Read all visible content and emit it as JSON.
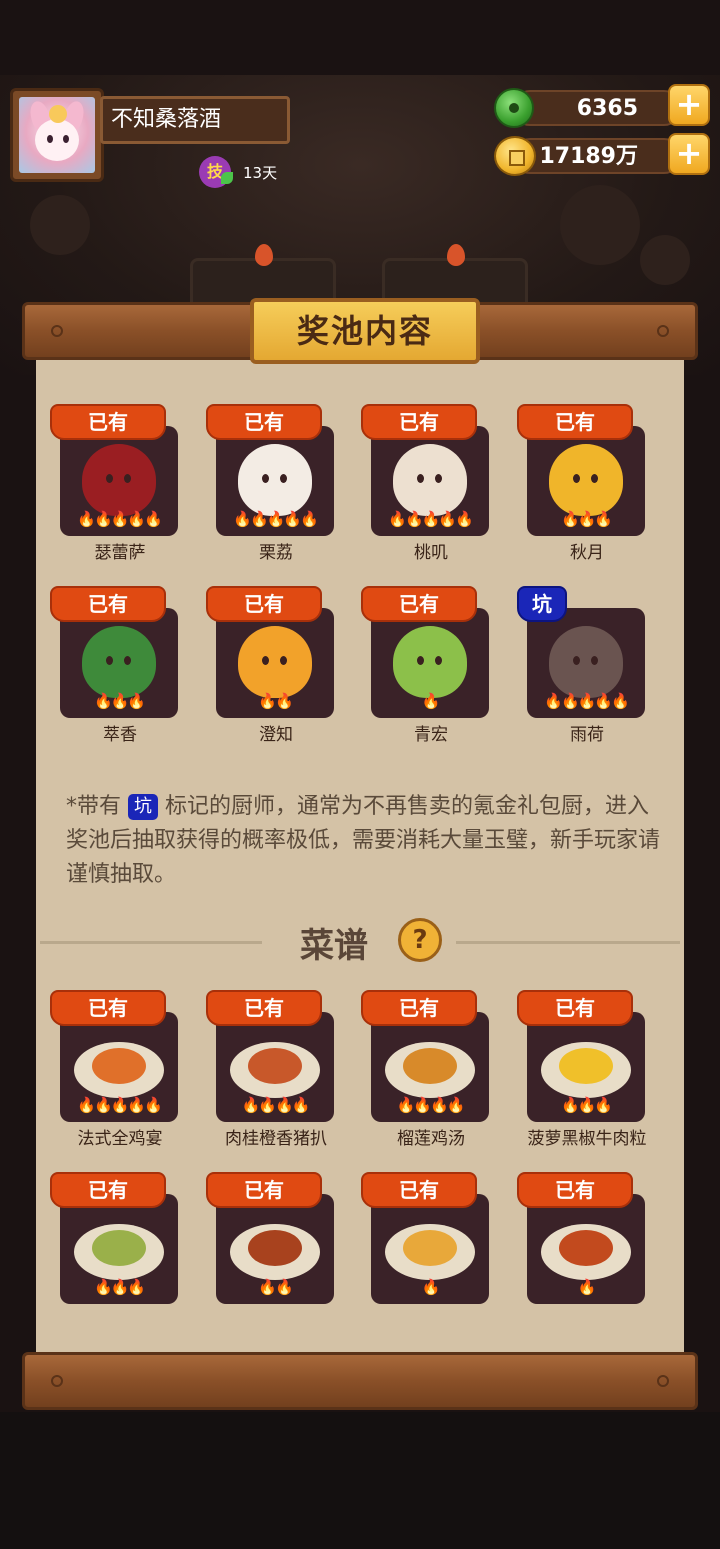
{
  "profile": {
    "name": "不知桑落酒",
    "skill_badge": "技",
    "days": "13天"
  },
  "currency": {
    "jade": "6365",
    "coins": "17189万"
  },
  "panel": {
    "title": "奖池内容",
    "chefs": [
      {
        "tag": "已有",
        "name": "瑟蕾萨",
        "stars": "🔥🔥🔥🔥🔥",
        "color": "#9a1e22"
      },
      {
        "tag": "已有",
        "name": "栗荔",
        "stars": "🔥🔥🔥🔥🔥",
        "color": "#f3ece4"
      },
      {
        "tag": "已有",
        "name": "桃叽",
        "stars": "🔥🔥🔥🔥🔥",
        "color": "#ede0d0"
      },
      {
        "tag": "已有",
        "name": "秋月",
        "stars": "🔥🔥🔥",
        "color": "#f0b52a"
      },
      {
        "tag": "已有",
        "name": "萃香",
        "stars": "🔥🔥🔥",
        "color": "#3e8a3a"
      },
      {
        "tag": "已有",
        "name": "澄知",
        "stars": "🔥🔥",
        "color": "#f2a22a"
      },
      {
        "tag": "已有",
        "name": "青宏",
        "stars": "🔥",
        "color": "#8cc04a"
      },
      {
        "tag": "坑",
        "name": "雨荷",
        "stars": "🔥🔥🔥🔥🔥",
        "color": "#6a5450"
      }
    ],
    "note_prefix": "*带有",
    "note_badge": "坑",
    "note_body": "标记的厨师，通常为不再售卖的氪金礼包厨，进入奖池后抽取获得的概率极低，需要消耗大量玉璧，新手玩家请谨慎抽取。",
    "recipes_title": "菜谱",
    "help_label": "?",
    "recipes": [
      {
        "tag": "已有",
        "name": "法式全鸡宴",
        "stars": "🔥🔥🔥🔥🔥",
        "color": "#e0702a"
      },
      {
        "tag": "已有",
        "name": "肉桂橙香猪扒",
        "stars": "🔥🔥🔥🔥",
        "color": "#c8582a"
      },
      {
        "tag": "已有",
        "name": "榴莲鸡汤",
        "stars": "🔥🔥🔥🔥",
        "color": "#d88a2a"
      },
      {
        "tag": "已有",
        "name": "菠萝黑椒牛肉粒",
        "stars": "🔥🔥🔥",
        "color": "#f0c02a"
      },
      {
        "tag": "已有",
        "name": "",
        "stars": "🔥🔥🔥",
        "color": "#9ab04a"
      },
      {
        "tag": "已有",
        "name": "",
        "stars": "🔥🔥",
        "color": "#a8421e"
      },
      {
        "tag": "已有",
        "name": "",
        "stars": "🔥",
        "color": "#e8a83a"
      },
      {
        "tag": "已有",
        "name": "",
        "stars": "🔥",
        "color": "#c24a1e"
      }
    ]
  },
  "colors": {
    "tag_owned": "#e04a12",
    "tag_pit": "#1a26b8",
    "panel": "#d4c2a6"
  }
}
